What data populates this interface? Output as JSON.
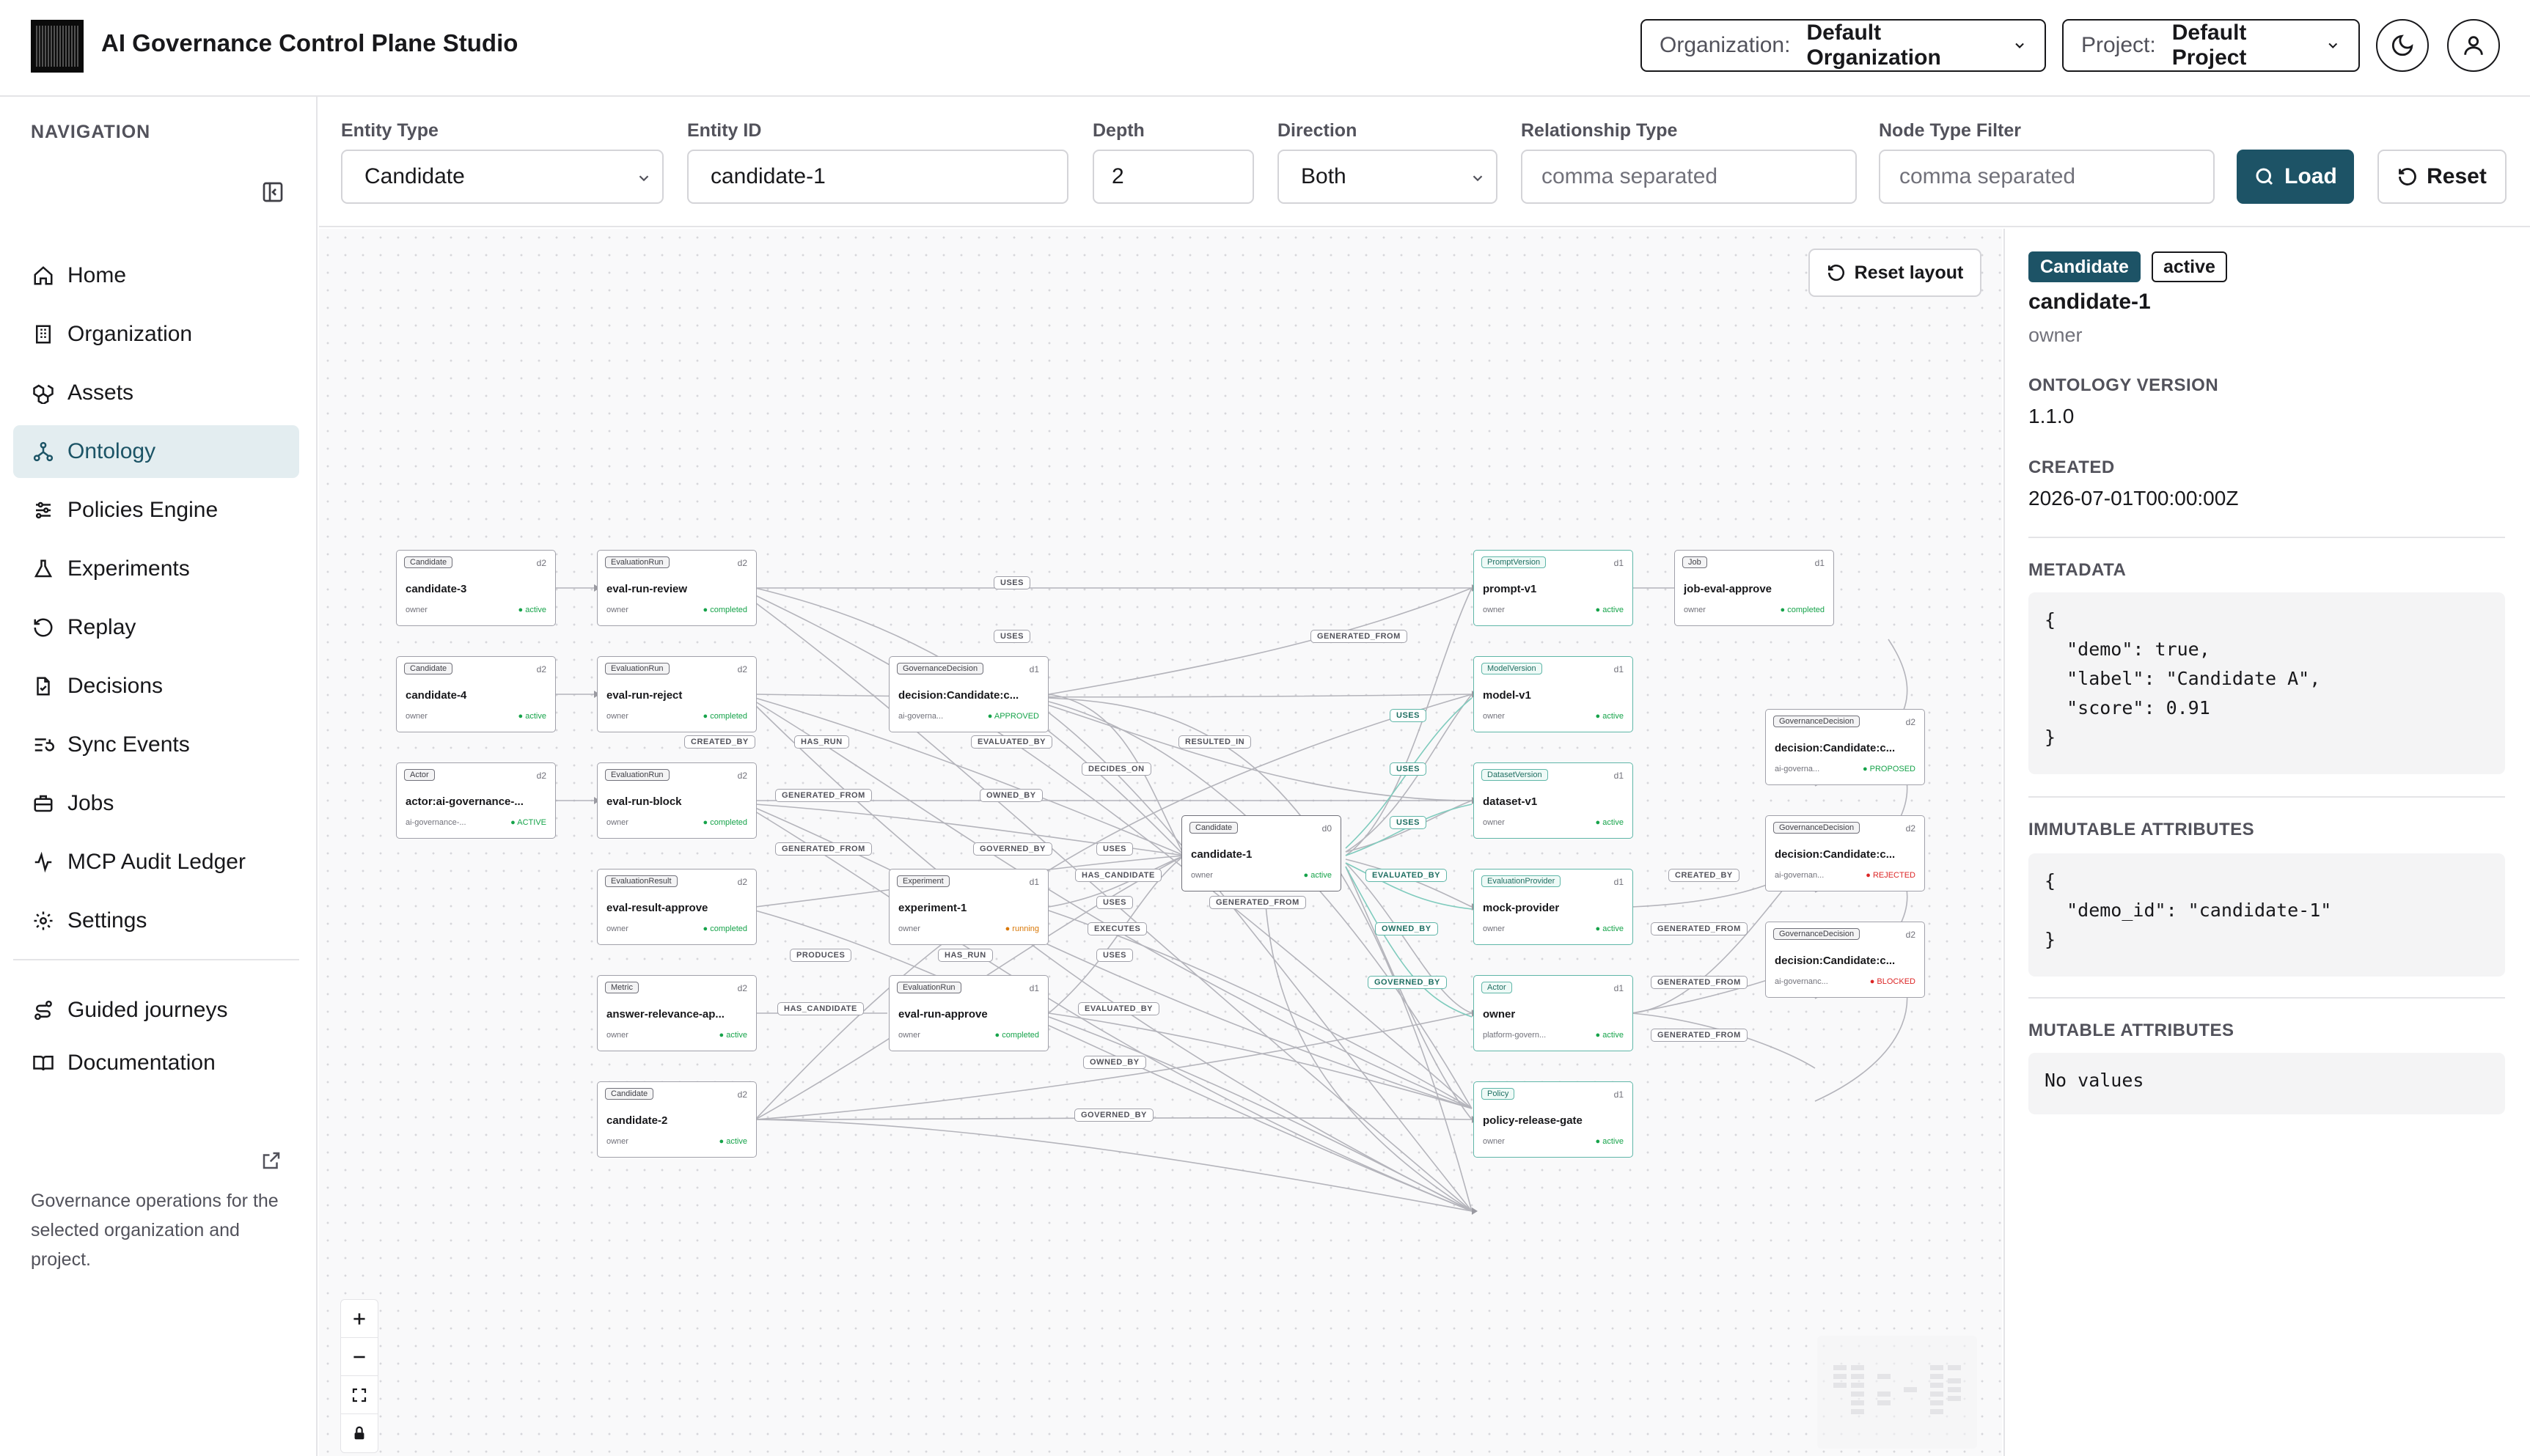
{
  "app": {
    "title": "AI Governance Control Plane Studio"
  },
  "header": {
    "organization_label": "Organization:",
    "organization_value": "Default Organization",
    "project_label": "Project:",
    "project_value": "Default Project"
  },
  "sidebar": {
    "heading": "NAVIGATION",
    "items": [
      {
        "label": "Home",
        "icon": "home-icon"
      },
      {
        "label": "Organization",
        "icon": "building-icon"
      },
      {
        "label": "Assets",
        "icon": "boxes-icon"
      },
      {
        "label": "Ontology",
        "icon": "network-icon",
        "active": true
      },
      {
        "label": "Policies Engine",
        "icon": "sliders-icon"
      },
      {
        "label": "Experiments",
        "icon": "flask-icon"
      },
      {
        "label": "Replay",
        "icon": "rotate-icon"
      },
      {
        "label": "Decisions",
        "icon": "file-check-icon"
      },
      {
        "label": "Sync Events",
        "icon": "list-sync-icon"
      },
      {
        "label": "Jobs",
        "icon": "briefcase-icon"
      },
      {
        "label": "MCP Audit Ledger",
        "icon": "activity-icon"
      },
      {
        "label": "Settings",
        "icon": "gear-icon"
      }
    ],
    "secondary": [
      {
        "label": "Guided journeys",
        "icon": "route-icon"
      },
      {
        "label": "Documentation",
        "icon": "book-icon"
      }
    ],
    "footer_text": "Governance operations for the selected organization and project."
  },
  "filters": {
    "entity_type": {
      "label": "Entity Type",
      "value": "Candidate"
    },
    "entity_id": {
      "label": "Entity ID",
      "value": "candidate-1"
    },
    "depth": {
      "label": "Depth",
      "value": "2"
    },
    "direction": {
      "label": "Direction",
      "value": "Both"
    },
    "relationship_type": {
      "label": "Relationship Type",
      "placeholder": "comma separated"
    },
    "node_type_filter": {
      "label": "Node Type Filter",
      "placeholder": "comma separated"
    },
    "load_label": "Load",
    "reset_label": "Reset"
  },
  "graph": {
    "reset_layout_label": "Reset layout",
    "nodes": [
      {
        "id": "candidate-3",
        "type": "Candidate",
        "depth": "d2",
        "owner": "owner",
        "status": "active"
      },
      {
        "id": "candidate-4",
        "type": "Candidate",
        "depth": "d2",
        "owner": "owner",
        "status": "active"
      },
      {
        "id": "actor",
        "type": "Actor",
        "name": "actor:ai-governance-...",
        "depth": "d2",
        "owner": "ai-governance-...",
        "status": "ACTIVE"
      },
      {
        "id": "eval-run-review",
        "type": "EvaluationRun",
        "depth": "d2",
        "owner": "owner",
        "status": "completed"
      },
      {
        "id": "eval-run-reject",
        "type": "EvaluationRun",
        "depth": "d2",
        "owner": "owner",
        "status": "completed"
      },
      {
        "id": "eval-run-block",
        "type": "EvaluationRun",
        "depth": "d2",
        "owner": "owner",
        "status": "completed"
      },
      {
        "id": "eval-result-approve",
        "type": "EvaluationResult",
        "depth": "d2",
        "owner": "owner",
        "status": "completed"
      },
      {
        "id": "answer-relevance-ap...",
        "type": "Metric",
        "depth": "d2",
        "owner": "owner",
        "status": "active"
      },
      {
        "id": "candidate-2",
        "type": "Candidate",
        "depth": "d2",
        "owner": "owner",
        "status": "active"
      },
      {
        "id": "decision:Candidate:c...",
        "type": "GovernanceDecision",
        "depth": "d1",
        "owner": "ai-governa...",
        "status": "APPROVED"
      },
      {
        "id": "experiment-1",
        "type": "Experiment",
        "depth": "d1",
        "owner": "owner",
        "status": "running"
      },
      {
        "id": "eval-run-approve",
        "type": "EvaluationRun",
        "depth": "d1",
        "owner": "owner",
        "status": "completed"
      },
      {
        "id": "candidate-1",
        "type": "Candidate",
        "depth": "d0",
        "owner": "owner",
        "status": "active"
      },
      {
        "id": "prompt-v1",
        "type": "PromptVersion",
        "depth": "d1",
        "owner": "owner",
        "status": "active"
      },
      {
        "id": "model-v1",
        "type": "ModelVersion",
        "depth": "d1",
        "owner": "owner",
        "status": "active"
      },
      {
        "id": "dataset-v1",
        "type": "DatasetVersion",
        "depth": "d1",
        "owner": "owner",
        "status": "active"
      },
      {
        "id": "mock-provider",
        "type": "EvaluationProvider",
        "depth": "d1",
        "owner": "owner",
        "status": "active"
      },
      {
        "id": "owner",
        "type": "Actor",
        "depth": "d1",
        "owner": "platform-govern...",
        "status": "active"
      },
      {
        "id": "policy-release-gate",
        "type": "Policy",
        "depth": "d1",
        "owner": "owner",
        "status": "active"
      },
      {
        "id": "job-eval-approve",
        "type": "Job",
        "depth": "d1",
        "owner": "owner",
        "status": "completed"
      },
      {
        "id": "decision:Candidate:c...",
        "type": "GovernanceDecision",
        "depth": "d2",
        "owner": "ai-governa...",
        "status": "PROPOSED"
      },
      {
        "id": "decision:Candidate:c...",
        "type": "GovernanceDecision",
        "depth": "d2",
        "owner": "ai-governan...",
        "status": "REJECTED"
      },
      {
        "id": "decision:Candidate:c...",
        "type": "GovernanceDecision",
        "depth": "d2",
        "owner": "ai-governanc...",
        "status": "BLOCKED"
      }
    ],
    "edge_labels": [
      "USES",
      "USES",
      "GENERATED_FROM",
      "USES",
      "CREATED_BY",
      "HAS_RUN",
      "EVALUATED_BY",
      "RESULTED_IN",
      "USES",
      "DECIDES_ON",
      "GENERATED_FROM",
      "OWNED_BY",
      "USES",
      "GENERATED_FROM",
      "GOVERNED_BY",
      "USES",
      "HAS_CANDIDATE",
      "EVALUATED_BY",
      "CREATED_BY",
      "USES",
      "GENERATED_FROM",
      "OWNED_BY",
      "EXECUTES",
      "GENERATED_FROM",
      "PRODUCES",
      "HAS_RUN",
      "USES",
      "GOVERNED_BY",
      "GENERATED_FROM",
      "HAS_CANDIDATE",
      "EVALUATED_BY",
      "GENERATED_FROM",
      "OWNED_BY",
      "GOVERNED_BY"
    ]
  },
  "details": {
    "type_tag": "Candidate",
    "status_tag": "active",
    "name": "candidate-1",
    "owner": "owner",
    "ontology_version_label": "ONTOLOGY VERSION",
    "ontology_version": "1.1.0",
    "created_label": "CREATED",
    "created": "2026-07-01T00:00:00Z",
    "metadata_label": "METADATA",
    "metadata_json": "{\n  \"demo\": true,\n  \"label\": \"Candidate A\",\n  \"score\": 0.91\n}",
    "immutable_label": "IMMUTABLE ATTRIBUTES",
    "immutable_json": "{\n  \"demo_id\": \"candidate-1\"\n}",
    "mutable_label": "MUTABLE ATTRIBUTES",
    "mutable_value": "No values"
  },
  "colors": {
    "accent": "#1d5366",
    "active_nav_bg": "#e3edf0",
    "status_green": "#16a34a",
    "status_red": "#dc2626",
    "status_amber": "#d97706",
    "teal_border": "#5fb6a8"
  }
}
